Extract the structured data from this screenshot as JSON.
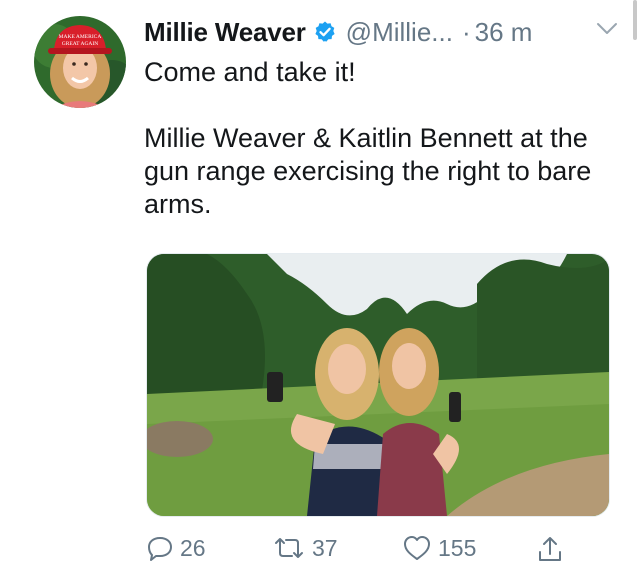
{
  "tweet": {
    "author_name": "Millie Weaver",
    "handle": "@Millie...",
    "separator": "·",
    "time": "36 m",
    "text": "Come and take it!\n\nMillie Weaver & Kaitlin Bennett at the gun range exercising the right to bare arms.",
    "avatar": {
      "hat_text_line1": "MAKE AMERICA",
      "hat_text_line2": "GREAT AGAIN"
    }
  },
  "actions": {
    "reply_count": "26",
    "retweet_count": "37",
    "like_count": "155"
  },
  "icons": {
    "verified": "verified-badge-icon",
    "caret": "chevron-down-icon",
    "reply": "reply-icon",
    "retweet": "retweet-icon",
    "like": "heart-icon",
    "share": "share-icon"
  },
  "colors": {
    "text": "#14171a",
    "secondary": "#657786",
    "verified": "#1da1f2"
  }
}
